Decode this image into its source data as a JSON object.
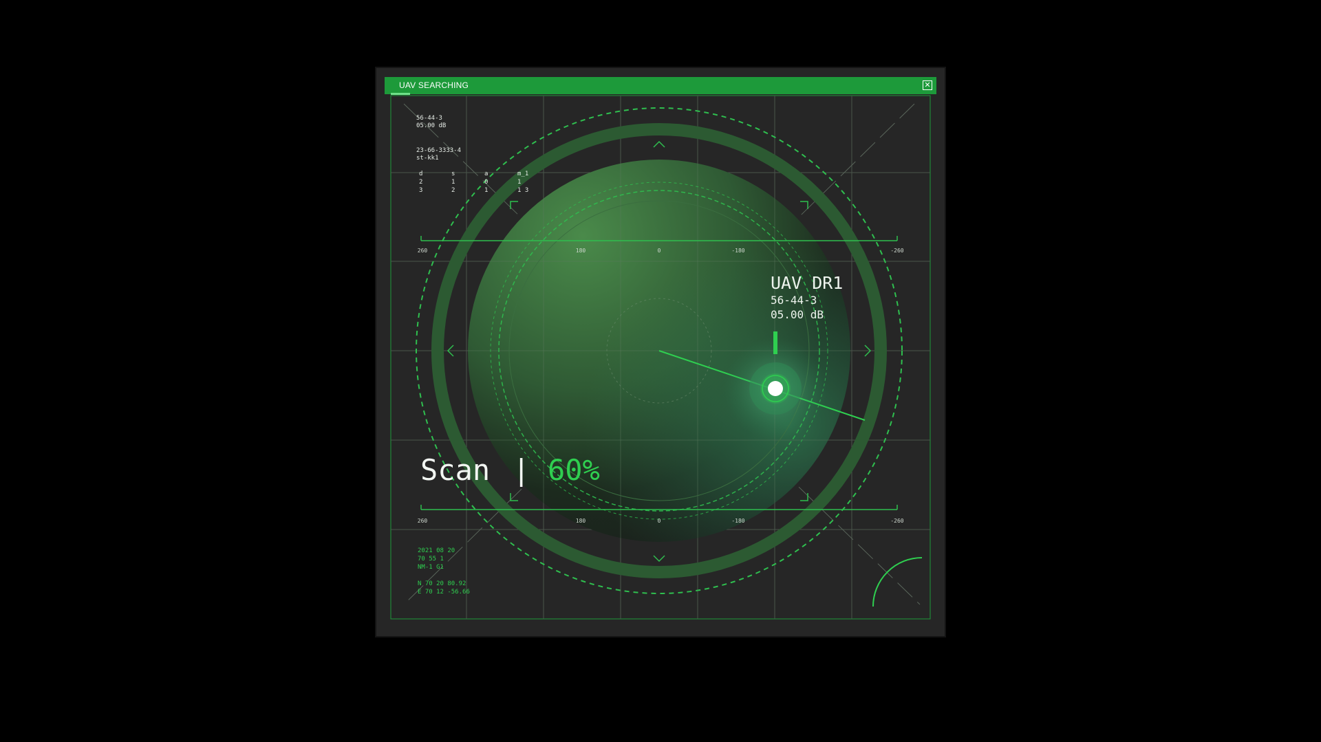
{
  "window": {
    "title": "UAV SEARCHING",
    "close_label": "✕"
  },
  "info_block": {
    "line1": "56-44-3",
    "line2": "05.00 dB",
    "line3": "23-66-3333-4",
    "line4": "st-kk1"
  },
  "mini_table": {
    "headers": [
      "d",
      "s",
      "a",
      "m_1"
    ],
    "rows": [
      [
        "2",
        "1",
        "0",
        "1"
      ],
      [
        "3",
        "2",
        "1",
        "1 3"
      ]
    ]
  },
  "top_scale": {
    "labels": [
      "260",
      "180",
      "0",
      "-180",
      "-260"
    ]
  },
  "bottom_scale": {
    "labels": [
      "260",
      "180",
      "0",
      "-180",
      "-260"
    ]
  },
  "target": {
    "name": "UAV DR1",
    "id": "56-44-3",
    "signal": "05.00 dB"
  },
  "scan": {
    "label": "Scan",
    "separator": "|",
    "value": "60%",
    "progress": 0.6
  },
  "footer_block": {
    "date": "2021 08 20",
    "code": "70 55 1",
    "unit": "NM-1 G1",
    "north": "N  70 20 80.92",
    "east": "E  70 12 -56.66"
  },
  "colors": {
    "accent": "#1d9a3a",
    "bright_green": "#33cc55",
    "grid": "#5a6a5a",
    "panel": "#262626",
    "background": "#000000"
  },
  "icons": [
    "close-icon",
    "chevron-up-icon",
    "chevron-down-icon",
    "chevron-left-icon",
    "chevron-right-icon"
  ]
}
